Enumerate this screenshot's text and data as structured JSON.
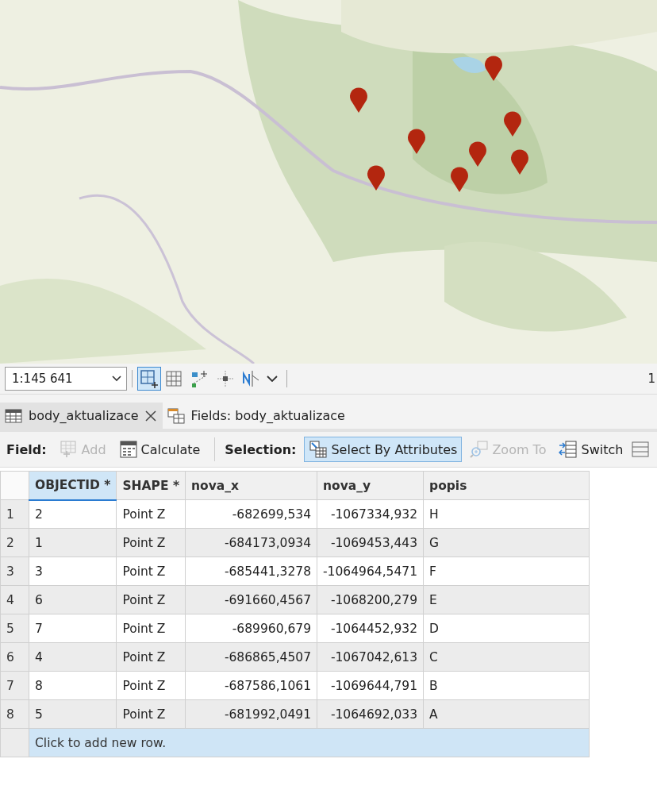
{
  "map_toolbar": {
    "scale": "1:145 641",
    "tools": [
      {
        "kind": "grid-add",
        "selected": true
      },
      {
        "kind": "grid",
        "selected": false
      },
      {
        "kind": "snap",
        "selected": false
      },
      {
        "kind": "crosshair",
        "selected": false
      },
      {
        "kind": "north",
        "selected": false
      },
      {
        "kind": "caret",
        "selected": false
      }
    ],
    "right_text": "1"
  },
  "tabs": [
    {
      "label": "body_aktualizace",
      "kind": "table",
      "selected": true,
      "closable": true
    },
    {
      "label": "Fields: body_aktualizace",
      "kind": "fields",
      "selected": false,
      "closable": false
    }
  ],
  "ribbon": [
    {
      "kind": "label",
      "label": "Field:"
    },
    {
      "kind": "button",
      "label": "Add",
      "disabled": true,
      "selected": false
    },
    {
      "kind": "button",
      "label": "Calculate",
      "disabled": false,
      "selected": false
    },
    {
      "kind": "separator"
    },
    {
      "kind": "label",
      "label": "Selection:"
    },
    {
      "kind": "button",
      "label": "Select By Attributes",
      "disabled": false,
      "selected": true
    },
    {
      "kind": "button",
      "label": "Zoom To",
      "disabled": true,
      "selected": false
    },
    {
      "kind": "button",
      "label": "Switch",
      "disabled": false,
      "selected": false
    },
    {
      "kind": "icon"
    }
  ],
  "table": {
    "columns": [
      {
        "label": "OBJECTID *",
        "selected": true
      },
      {
        "label": "SHAPE *",
        "selected": false
      },
      {
        "label": "nova_x",
        "selected": false
      },
      {
        "label": "nova_y",
        "selected": false
      },
      {
        "label": "popis",
        "selected": false
      }
    ],
    "rows": [
      {
        "number": "1",
        "cells": [
          "2",
          "Point Z",
          "-682699,534",
          "-1067334,932",
          "H"
        ]
      },
      {
        "number": "2",
        "cells": [
          "1",
          "Point Z",
          "-684173,0934",
          "-1069453,443",
          "G"
        ]
      },
      {
        "number": "3",
        "cells": [
          "3",
          "Point Z",
          "-685441,3278",
          "-1064964,5471",
          "F"
        ]
      },
      {
        "number": "4",
        "cells": [
          "6",
          "Point Z",
          "-691660,4567",
          "-1068200,279",
          "E"
        ]
      },
      {
        "number": "5",
        "cells": [
          "7",
          "Point Z",
          "-689960,679",
          "-1064452,932",
          "D"
        ]
      },
      {
        "number": "6",
        "cells": [
          "4",
          "Point Z",
          "-686865,4507",
          "-1067042,613",
          "C"
        ]
      },
      {
        "number": "7",
        "cells": [
          "8",
          "Point Z",
          "-687586,1061",
          "-1069644,791",
          "B"
        ]
      },
      {
        "number": "8",
        "cells": [
          "5",
          "Point Z",
          "-681992,0491",
          "-1064692,033",
          "A"
        ]
      }
    ],
    "add_row": "Click to add new row."
  }
}
